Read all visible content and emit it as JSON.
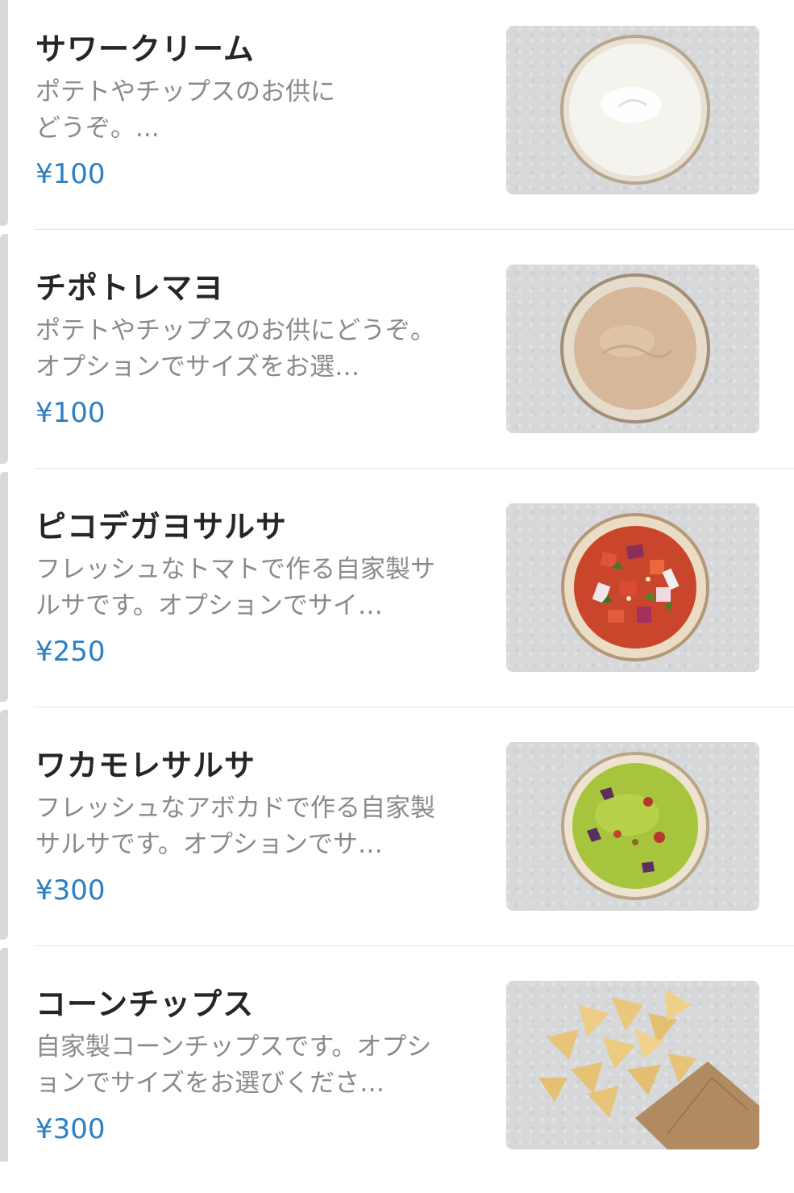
{
  "menu_items": [
    {
      "name": "サワークリーム",
      "description": "ポテトやチップスのお供に\nどうぞ。...",
      "price": "¥100",
      "image_icon": "sour-cream-bowl"
    },
    {
      "name": "チポトレマヨ",
      "description": "ポテトやチップスのお供にどうぞ。オプションでサイズをお選…",
      "price": "¥100",
      "image_icon": "chipotle-mayo-bowl"
    },
    {
      "name": "ピコデガヨサルサ",
      "description": "フレッシュなトマトで作る自家製サルサです。オプションでサイ…",
      "price": "¥250",
      "image_icon": "pico-de-gallo-bowl"
    },
    {
      "name": "ワカモレサルサ",
      "description": "フレッシュなアボカドで作る自家製サルサです。オプションでサ…",
      "price": "¥300",
      "image_icon": "guacamole-bowl"
    },
    {
      "name": "コーンチップス",
      "description": "自家製コーンチップスです。オプションでサイズをお選びくださ…",
      "price": "¥300",
      "image_icon": "corn-chips-bag"
    }
  ],
  "colors": {
    "price": "#2b7fc3",
    "name": "#262626",
    "description": "#8a8a8a",
    "divider": "#e4e4e4"
  }
}
